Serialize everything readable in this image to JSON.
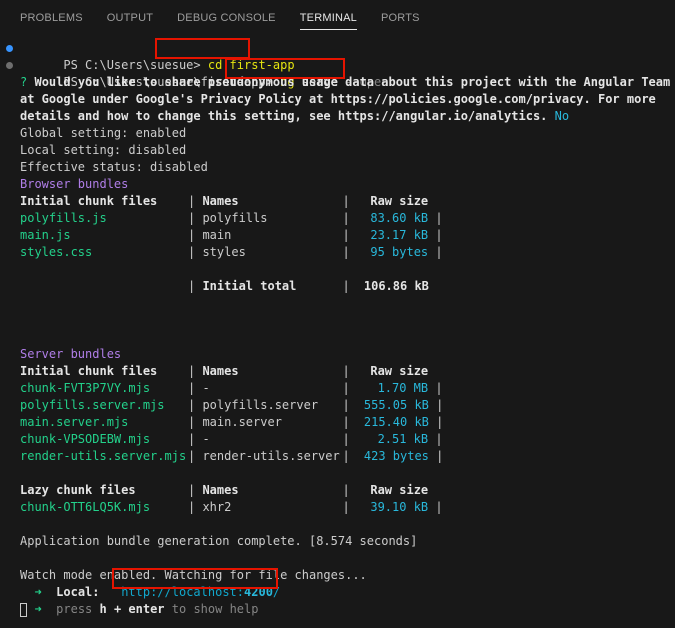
{
  "tabs": [
    "PROBLEMS",
    "OUTPUT",
    "DEBUG CONSOLE",
    "TERMINAL",
    "PORTS"
  ],
  "active_tab": "TERMINAL",
  "cmd1": {
    "prompt": "PS C:\\Users\\suesue>",
    "command": "cd first-app"
  },
  "cmd2": {
    "prompt": "PS C:\\Users\\suesue\\first-app>",
    "command_name": "ng",
    "command_args": "serve",
    "command_flag": "--open"
  },
  "question": {
    "mark": "?",
    "lines": [
      "Would you like to share pseudonymous usage data about this project with the Angular Team",
      "at Google under Google's Privacy Policy at https://policies.google.com/privacy. For more",
      "details and how to change this setting, see https://angular.io/analytics."
    ],
    "answer": "No"
  },
  "settings": [
    "Global setting: enabled",
    "Local setting: disabled",
    "Effective status: disabled"
  ],
  "browser": {
    "title": "Browser bundles",
    "headers": [
      "Initial chunk files",
      "Names",
      "Raw size"
    ],
    "rows": [
      {
        "file": "polyfills.js",
        "name": "polyfills",
        "size": "83.60 kB"
      },
      {
        "file": "main.js",
        "name": "main",
        "size": "23.17 kB"
      },
      {
        "file": "styles.css",
        "name": "styles",
        "size": "95 bytes"
      }
    ],
    "total_label": "Initial total",
    "total_value": "106.86 kB"
  },
  "server": {
    "title": "Server bundles",
    "headers": [
      "Initial chunk files",
      "Names",
      "Raw size"
    ],
    "rows": [
      {
        "file": "chunk-FVT3P7VY.mjs",
        "name": "-",
        "size": "1.70 MB"
      },
      {
        "file": "polyfills.server.mjs",
        "name": "polyfills.server",
        "size": "555.05 kB"
      },
      {
        "file": "main.server.mjs",
        "name": "main.server",
        "size": "215.40 kB"
      },
      {
        "file": "chunk-VPSODEBW.mjs",
        "name": "-",
        "size": "2.51 kB"
      },
      {
        "file": "render-utils.server.mjs",
        "name": "render-utils.server",
        "size": "423 bytes"
      }
    ]
  },
  "lazy": {
    "headers": [
      "Lazy chunk files",
      "Names",
      "Raw size"
    ],
    "rows": [
      {
        "file": "chunk-OTT6LQ5K.mjs",
        "name": "xhr2",
        "size": "39.10 kB"
      }
    ]
  },
  "complete": "Application bundle generation complete. [8.574 seconds]",
  "watch": "Watch mode enabled. Watching for file changes...",
  "local": {
    "arrow": "➜",
    "label": "Local:",
    "url_prefix": "http://localhost:",
    "port": "4200",
    "url_suffix": "/"
  },
  "help": {
    "arrow": "➜",
    "text1": "press",
    "key": "h + enter",
    "text2": "to show help"
  },
  "colors": {
    "highlight_box": "#e51400",
    "background": "#181818",
    "accent": "#3794ff"
  }
}
